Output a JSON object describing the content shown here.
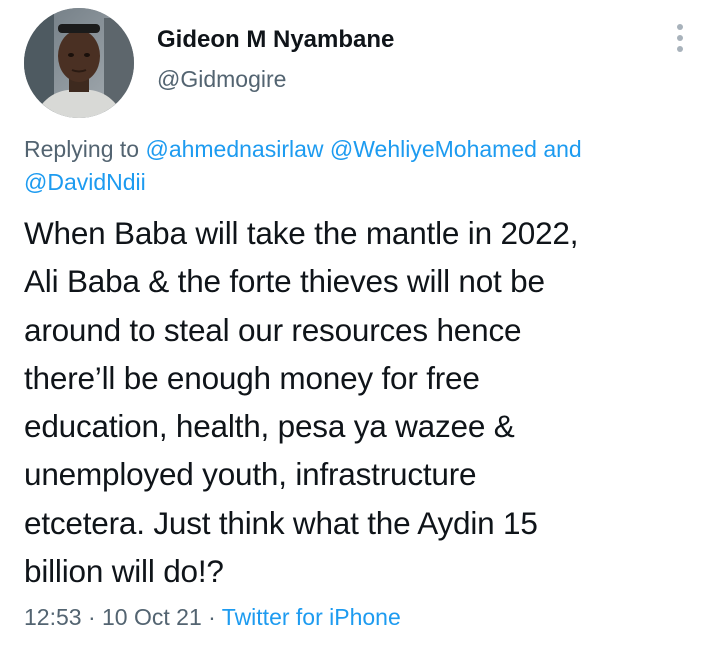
{
  "author": {
    "display_name": "Gideon M Nyambane",
    "handle": "@Gidmogire"
  },
  "reply_context": {
    "prefix": "Replying to",
    "mentions": [
      "@ahmednasirlaw",
      "@WehliyeMohamed"
    ],
    "conjunction": "and",
    "last_mention": "@DavidNdii"
  },
  "tweet": {
    "lines": [
      "When Baba will take the mantle in 2022,",
      "Ali Baba & the forte thieves will not be",
      "around to steal our resources hence",
      "there’ll be enough money for free",
      "education, health, pesa ya wazee &",
      "unemployed youth, infrastructure",
      "etcetera. Just think what the Aydin 15",
      "billion will do!?"
    ]
  },
  "meta": {
    "time": "12:53",
    "separator": "·",
    "date": "10 Oct 21",
    "source": "Twitter for iPhone"
  },
  "icons": {
    "more": "more-options-icon",
    "avatar": "profile-photo"
  },
  "colors": {
    "link": "#1d9bf0",
    "secondary_text": "#536471",
    "primary_text": "#0f1419"
  }
}
